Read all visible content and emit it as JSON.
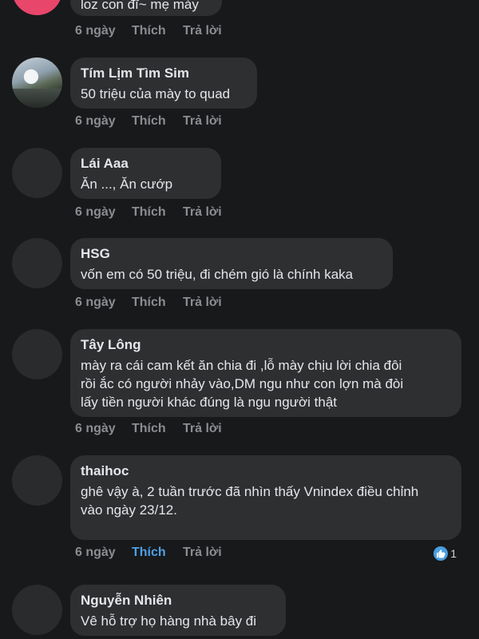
{
  "comments": [
    {
      "author": "",
      "text": "loz con đĩ~ mẹ mày",
      "time": "6 ngày",
      "like": "Thích",
      "reply": "Trả lời"
    },
    {
      "author": "Tím Lịm Tìm Sim",
      "text": "50 triệu của mày to quad",
      "time": "6 ngày",
      "like": "Thích",
      "reply": "Trả lời"
    },
    {
      "author": "Lái Aaa",
      "text": "Ăn ..., Ăn cướp",
      "time": "6 ngày",
      "like": "Thích",
      "reply": "Trả lời"
    },
    {
      "author": "HSG",
      "text": "vốn em có 50 triệu, đi chém gió là chính kaka",
      "time": "6 ngày",
      "like": "Thích",
      "reply": "Trả lời"
    },
    {
      "author": "Tây Lông",
      "text_lines": [
        "mày ra cái cam kết ăn chia đi ,lỗ mày chịu lời chia đôi",
        "rồi ắc có người nhảy vào,DM ngu như con lợn mà đòi",
        "lấy tiền người khác đúng là ngu người thật"
      ],
      "time": "6 ngày",
      "like": "Thích",
      "reply": "Trả lời"
    },
    {
      "author": "thaihoc",
      "text_lines": [
        "ghê vậy à, 2 tuần trước đã nhìn thấy Vnindex điều chỉnh",
        "vào ngày 23/12."
      ],
      "time": "6 ngày",
      "like": "Thích",
      "reply": "Trả lời",
      "reaction_count": "1"
    },
    {
      "author": "Nguyễn Nhiên",
      "text": "Vê hỗ trợ họ hàng nhà bây đi"
    }
  ],
  "colors": {
    "background": "#18191b",
    "bubble": "#2e2f31",
    "liked": "#4ea0e6"
  }
}
